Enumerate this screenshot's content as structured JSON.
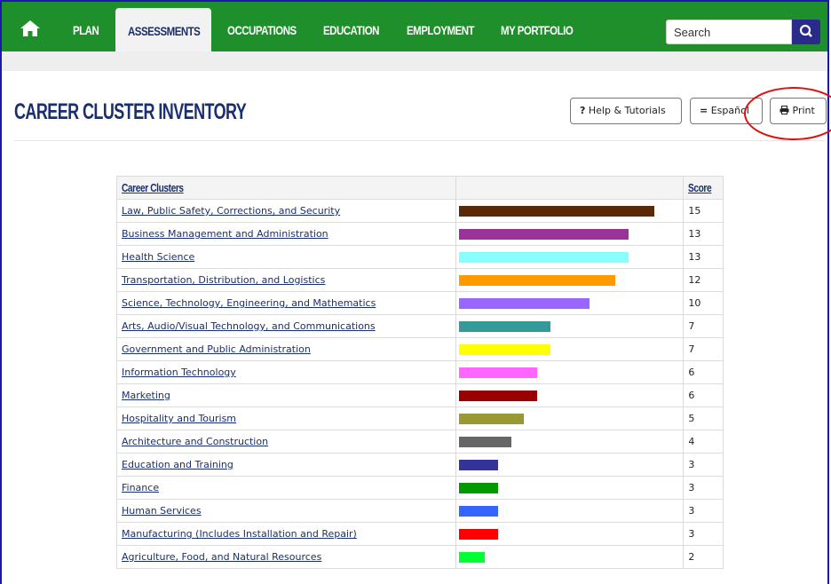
{
  "nav": {
    "items": [
      {
        "id": "plan",
        "label": "PLAN"
      },
      {
        "id": "assessments",
        "label": "ASSESSMENTS",
        "active": true
      },
      {
        "id": "occupations",
        "label": "OCCUPATIONS"
      },
      {
        "id": "education",
        "label": "EDUCATION"
      },
      {
        "id": "employment",
        "label": "EMPLOYMENT"
      },
      {
        "id": "my-portfolio",
        "label": "MY PORTFOLIO"
      }
    ],
    "search_placeholder": "Search",
    "search_icon": "search-icon",
    "home_icon": "home-icon",
    "color": "#1e8f2a"
  },
  "page": {
    "title": "CAREER CLUSTER INVENTORY",
    "help_label": "Help & Tutorials",
    "espanol_label": "Español",
    "print_label": "Print"
  },
  "table": {
    "col_clusters": "Career Clusters",
    "col_score": "Score",
    "max_score": 15,
    "rows": [
      {
        "name": "Law, Public Safety, Corrections, and Security",
        "score": "15",
        "color": "#5a2a08"
      },
      {
        "name": "Business Management and Administration",
        "score": "13",
        "color": "#993399"
      },
      {
        "name": "Health Science",
        "score": "13",
        "color": "#88ffff"
      },
      {
        "name": "Transportation, Distribution, and Logistics",
        "score": "12",
        "color": "#ff9900"
      },
      {
        "name": "Science, Technology, Engineering, and Mathematics",
        "score": "10",
        "color": "#9966ff"
      },
      {
        "name": "Arts, Audio/Visual Technology, and Communications",
        "score": "7",
        "color": "#339999"
      },
      {
        "name": "Government and Public Administration",
        "score": "7",
        "color": "#ffff00"
      },
      {
        "name": "Information Technology",
        "score": "6",
        "color": "#ff66ff"
      },
      {
        "name": "Marketing",
        "score": "6",
        "color": "#990000"
      },
      {
        "name": "Hospitality and Tourism",
        "score": "5",
        "color": "#999933"
      },
      {
        "name": "Architecture and Construction",
        "score": "4",
        "color": "#666666"
      },
      {
        "name": "Education and Training",
        "score": "3",
        "color": "#333399"
      },
      {
        "name": "Finance",
        "score": "3",
        "color": "#009900"
      },
      {
        "name": "Human Services",
        "score": "3",
        "color": "#3366ff"
      },
      {
        "name": "Manufacturing (Includes Installation and Repair)",
        "score": "3",
        "color": "#ff0000"
      },
      {
        "name": "Agriculture, Food, and Natural Resources",
        "score": "2",
        "color": "#00ff33"
      }
    ]
  },
  "annotation_color": "#e01010"
}
